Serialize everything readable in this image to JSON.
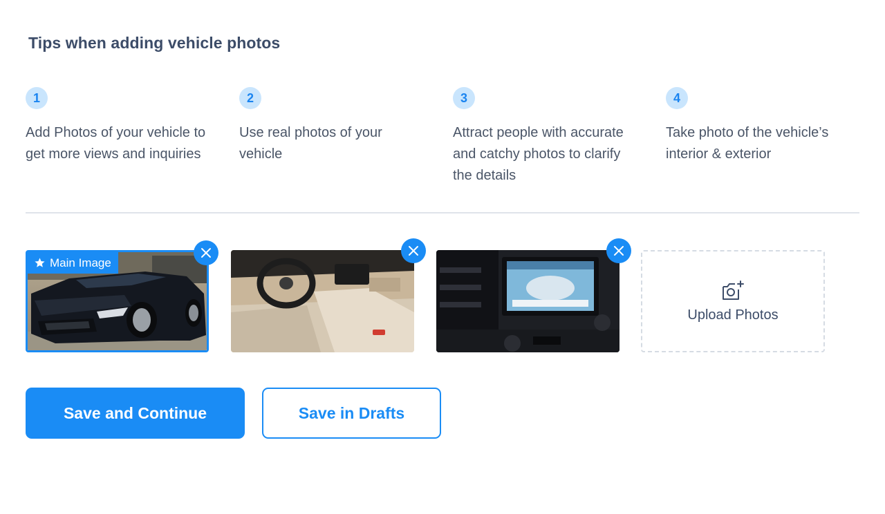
{
  "heading": "Tips when adding vehicle photos",
  "tips": [
    {
      "number": "1",
      "text": "Add Photos of your vehicle to get more views and inquiries"
    },
    {
      "number": "2",
      "text": "Use real photos of your vehicle"
    },
    {
      "number": "3",
      "text": "Attract people with accurate and catchy photos to clarify the details"
    },
    {
      "number": "4",
      "text": "Take photo of the vehicle’s interior & exterior"
    }
  ],
  "photos": {
    "main_badge": "Main Image",
    "items": [
      {
        "subject": "car-exterior-front",
        "is_main": true
      },
      {
        "subject": "car-interior-dashboard",
        "is_main": false
      },
      {
        "subject": "car-infotainment-screen",
        "is_main": false
      }
    ]
  },
  "upload": {
    "label": "Upload Photos"
  },
  "actions": {
    "primary_label": "Save and Continue",
    "secondary_label": "Save in Drafts"
  },
  "colors": {
    "accent": "#1a8cf5",
    "heading": "#3c4c68",
    "tip_badge_bg": "#c9e5fd",
    "divider": "#dfe3ea"
  }
}
